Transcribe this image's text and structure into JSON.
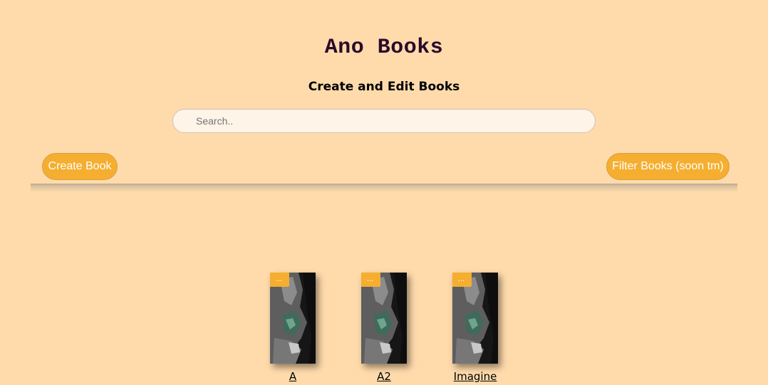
{
  "header": {
    "app_title": "Ano Books",
    "subtitle": "Create and Edit Books"
  },
  "search": {
    "placeholder": "Search.."
  },
  "toolbar": {
    "create_label": "Create Book",
    "filter_label": "Filter Books (soon tm)"
  },
  "books": [
    {
      "title": "A",
      "menu_label": "..."
    },
    {
      "title": "A2",
      "menu_label": "..."
    },
    {
      "title": "Imagine",
      "menu_label": "..."
    }
  ],
  "colors": {
    "background": "#FFDBAC",
    "accent": "#F5AE2F",
    "title": "#2a0a2a"
  }
}
